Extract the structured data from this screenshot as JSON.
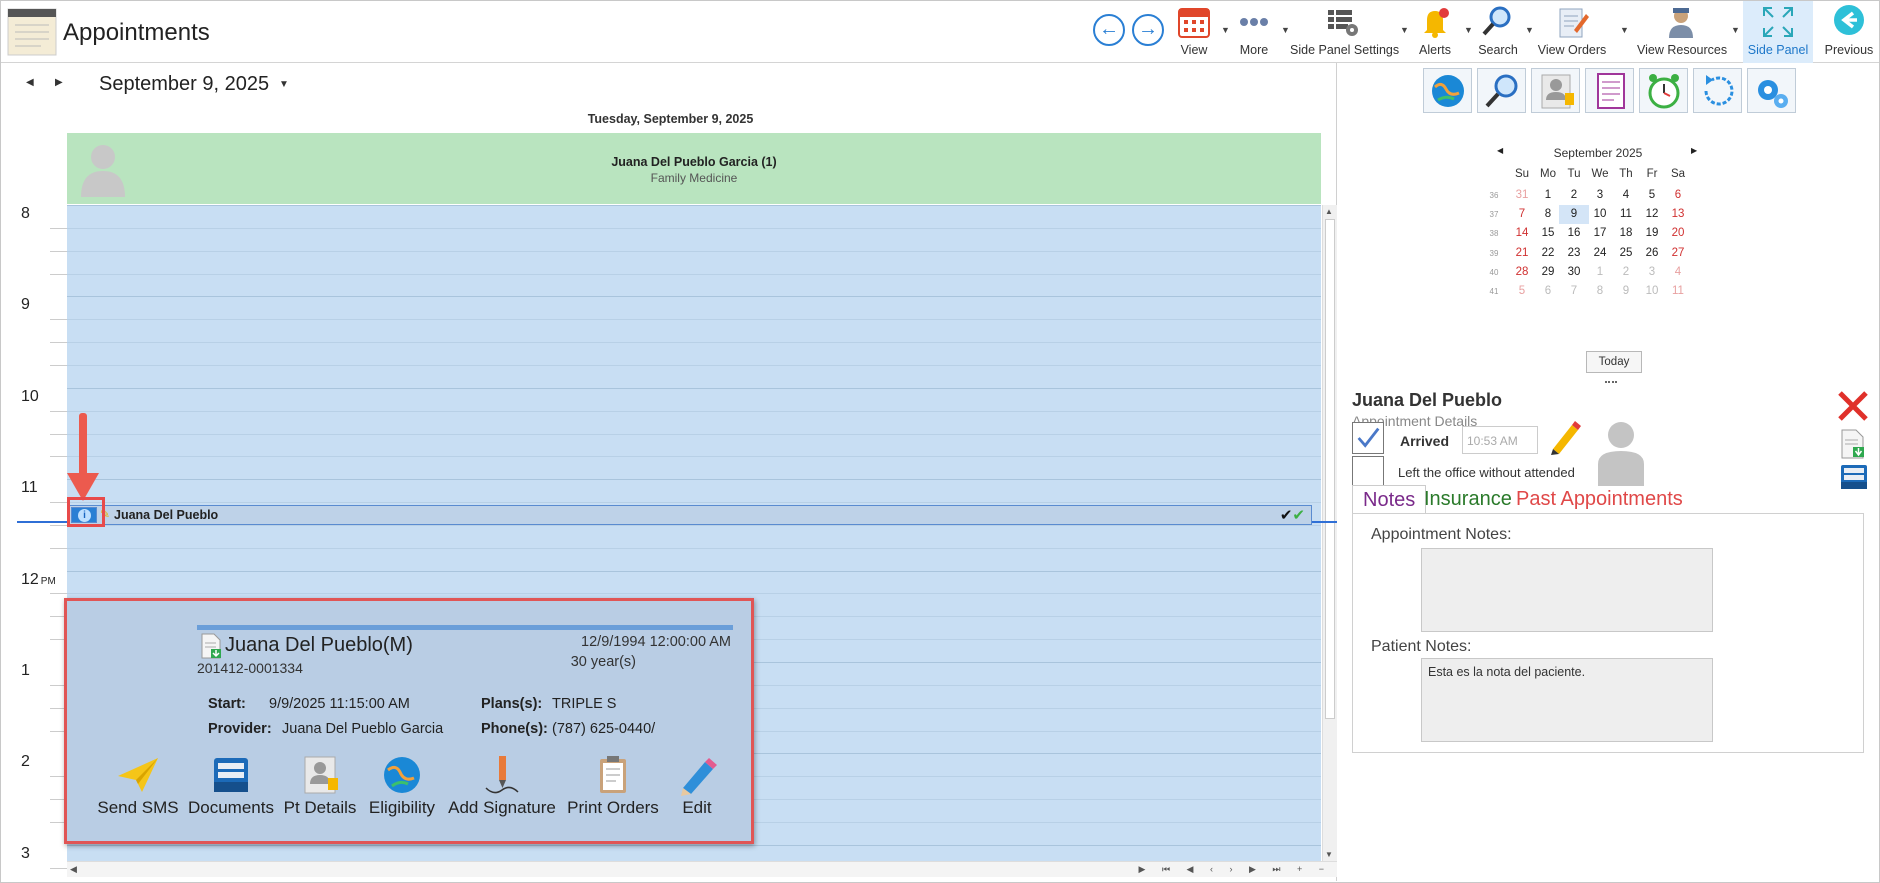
{
  "header": {
    "title": "Appointments",
    "toolbar": [
      {
        "id": "view",
        "label": "View",
        "icon": "calendar-icon"
      },
      {
        "id": "more",
        "label": "More",
        "icon": "more-dots-icon"
      },
      {
        "id": "side_panel_settings",
        "label": "Side Panel Settings",
        "icon": "grid-settings-icon"
      },
      {
        "id": "alerts",
        "label": "Alerts",
        "icon": "bell-icon"
      },
      {
        "id": "search",
        "label": "Search",
        "icon": "search-icon"
      },
      {
        "id": "view_orders",
        "label": "View Orders",
        "icon": "orders-icon"
      },
      {
        "id": "view_resources",
        "label": "View Resources",
        "icon": "resources-icon"
      },
      {
        "id": "side_panel",
        "label": "Side Panel",
        "icon": "expand-icon"
      },
      {
        "id": "previous",
        "label": "Previous",
        "icon": "back-circle-icon"
      }
    ]
  },
  "calendar": {
    "date_label": "September 9, 2025",
    "day_header": "Tuesday, September 9, 2025",
    "resource": {
      "name": "Juana Del Pueblo Garcia (1)",
      "department": "Family Medicine"
    },
    "hours": [
      {
        "label": "8",
        "pm": ""
      },
      {
        "label": "9",
        "pm": ""
      },
      {
        "label": "10",
        "pm": ""
      },
      {
        "label": "11",
        "pm": ""
      },
      {
        "label": "12",
        "pm": "PM"
      },
      {
        "label": "1",
        "pm": ""
      },
      {
        "label": "2",
        "pm": ""
      },
      {
        "label": "3",
        "pm": ""
      }
    ],
    "appointment": {
      "name": "Juana Del Pueblo",
      "info_icon": "i"
    }
  },
  "popup": {
    "patient_name": "Juana Del Pueblo(M)",
    "patient_id": "201412-0001334",
    "dob": "12/9/1994 12:00:00 AM",
    "age": "30 year(s)",
    "start_label": "Start:",
    "start_value": "9/9/2025 11:15:00 AM",
    "provider_label": "Provider:",
    "provider_value": "Juana Del Pueblo Garcia",
    "plans_label": "Plans(s):",
    "plans_value": "TRIPLE S",
    "phone_label": "Phone(s):",
    "phone_value": "(787) 625-0440/",
    "actions": [
      {
        "label": "Send SMS",
        "icon": "paper-plane-icon"
      },
      {
        "label": "Documents",
        "icon": "file-tray-icon"
      },
      {
        "label": "Pt Details",
        "icon": "patient-card-icon"
      },
      {
        "label": "Eligibility",
        "icon": "globe-icon"
      },
      {
        "label": "Add Signature",
        "icon": "signature-pen-icon"
      },
      {
        "label": "Print Orders",
        "icon": "clipboard-icon"
      },
      {
        "label": "Edit",
        "icon": "pencil-icon"
      }
    ]
  },
  "side_panel": {
    "icons": [
      "globe-icon",
      "search-icon",
      "patient-card-icon",
      "notes-icon",
      "alarm-clock-icon",
      "refresh-icon",
      "settings-gears-icon"
    ],
    "mini_calendar": {
      "title": "September 2025",
      "dow": [
        "Su",
        "Mo",
        "Tu",
        "We",
        "Th",
        "Fr",
        "Sa"
      ],
      "weeks": [
        {
          "wk": "36",
          "days": [
            "31",
            "1",
            "2",
            "3",
            "4",
            "5",
            "6"
          ]
        },
        {
          "wk": "37",
          "days": [
            "7",
            "8",
            "9",
            "10",
            "11",
            "12",
            "13"
          ]
        },
        {
          "wk": "38",
          "days": [
            "14",
            "15",
            "16",
            "17",
            "18",
            "19",
            "20"
          ]
        },
        {
          "wk": "39",
          "days": [
            "21",
            "22",
            "23",
            "24",
            "25",
            "26",
            "27"
          ]
        },
        {
          "wk": "40",
          "days": [
            "28",
            "29",
            "30",
            "1",
            "2",
            "3",
            "4"
          ]
        },
        {
          "wk": "41",
          "days": [
            "5",
            "6",
            "7",
            "8",
            "9",
            "10",
            "11"
          ]
        }
      ],
      "selected": "9",
      "today_label": "Today"
    },
    "patient_name": "Juana Del Pueblo",
    "subtitle": "Appointment Details",
    "arrived_label": "Arrived",
    "arrived_checked": true,
    "arrived_time": "10:53 AM",
    "left_label": "Left the office without attended",
    "tabs": [
      "Notes",
      "Insurance",
      "Past Appointments"
    ],
    "appointment_notes_label": "Appointment Notes:",
    "appointment_notes": "",
    "patient_notes_label": "Patient Notes:",
    "patient_notes": "Esta es la nota del paciente."
  }
}
